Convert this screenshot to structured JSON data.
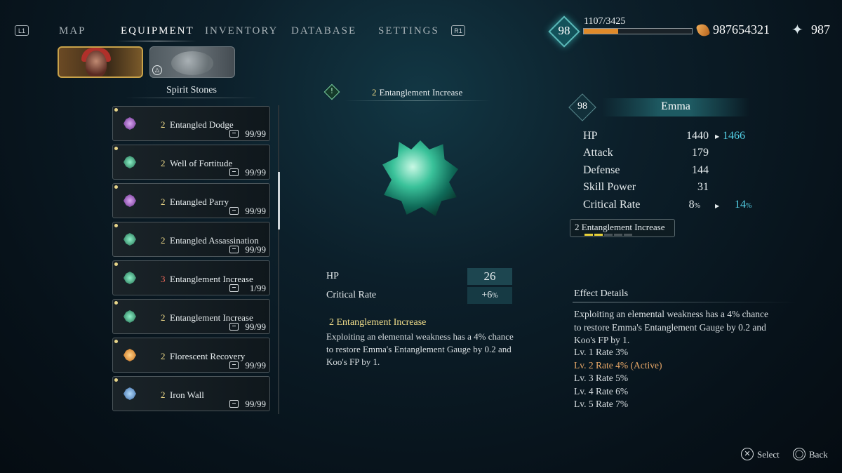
{
  "nav": {
    "left_trigger": "L1",
    "right_trigger": "R1",
    "tabs": [
      "MAP",
      "EQUIPMENT",
      "INVENTORY",
      "DATABASE",
      "SETTINGS"
    ],
    "active_tab": "EQUIPMENT"
  },
  "player": {
    "level": "98",
    "xp": "1107/3425",
    "xp_fraction": 0.32,
    "amber": "987654321",
    "spirit_points": "987"
  },
  "characters": {
    "second_tab_button": "△"
  },
  "list": {
    "title": "Spirit Stones",
    "items": [
      {
        "level": "2",
        "name": "Entangled Dodge",
        "qty": "99/99",
        "gem": "purple"
      },
      {
        "level": "2",
        "name": "Well of Fortitude",
        "qty": "99/99",
        "gem": "green"
      },
      {
        "level": "2",
        "name": "Entangled Parry",
        "qty": "99/99",
        "gem": "purple"
      },
      {
        "level": "2",
        "name": "Entangled Assassination",
        "qty": "99/99",
        "gem": "green"
      },
      {
        "level": "3",
        "name": "Entanglement Increase",
        "qty": "1/99",
        "gem": "green"
      },
      {
        "level": "2",
        "name": "Entanglement Increase",
        "qty": "99/99",
        "gem": "green"
      },
      {
        "level": "2",
        "name": "Florescent Recovery",
        "qty": "99/99",
        "gem": "orange"
      },
      {
        "level": "2",
        "name": "Iron Wall",
        "qty": "99/99",
        "gem": "blue"
      }
    ]
  },
  "detail": {
    "warn_glyph": "!",
    "level": "2",
    "title": "Entanglement Increase",
    "stats": [
      {
        "label": "HP",
        "value": "26"
      },
      {
        "label": "Critical Rate",
        "value": "+6",
        "unit": "%"
      }
    ],
    "desc_level": "2",
    "desc_title": "Entanglement Increase",
    "desc_pre1": "Exploiting an elemental weakness has a ",
    "desc_b1": "4%",
    "desc_pre2": " chance to restore Emma's Entanglement Gauge by ",
    "desc_b2": "0.2",
    "desc_pre3": " and Koo's FP by ",
    "desc_b3": "1",
    "desc_end": "."
  },
  "character": {
    "level": "98",
    "name": "Emma",
    "stats": {
      "hp_label": "HP",
      "hp": "1440",
      "hp_new": "1466",
      "attack_label": "Attack",
      "attack": "179",
      "defense_label": "Defense",
      "defense": "144",
      "skill_label": "Skill Power",
      "skill": "31",
      "crit_label": "Critical Rate",
      "crit": "8",
      "crit_new": "14",
      "pct": "%"
    },
    "equipped": {
      "level": "2",
      "name": "Entanglement Increase",
      "segments_filled": 2,
      "segments_total": 5
    }
  },
  "effects": {
    "label": "Effect Details",
    "pre1": "Exploiting an elemental weakness has a ",
    "b1": "4%",
    "pre2": " chance to restore Emma's Entanglement Gauge by ",
    "b2": "0.2",
    "pre3": " and Koo's FP by ",
    "b3": "1",
    "end": ".",
    "levels": [
      {
        "lv": "Lv. ",
        "n": "1",
        "rate": " Rate ",
        "v": "3%",
        "suffix": ""
      },
      {
        "lv": "Lv. ",
        "n": "2",
        "rate": " Rate ",
        "v": "4%",
        "suffix": " (Active)"
      },
      {
        "lv": "Lv. ",
        "n": "3",
        "rate": " Rate ",
        "v": "5%",
        "suffix": ""
      },
      {
        "lv": "Lv. ",
        "n": "4",
        "rate": " Rate ",
        "v": "6%",
        "suffix": ""
      },
      {
        "lv": "Lv. ",
        "n": "5",
        "rate": " Rate ",
        "v": "7%",
        "suffix": ""
      }
    ]
  },
  "footer": {
    "select_glyph": "✕",
    "select": "Select",
    "back_glyph": "◯",
    "back": "Back"
  },
  "colors": {
    "accent_gold": "#f0dc8a",
    "stat_increase": "#55d2e8",
    "active_level": "#e8a868",
    "xp_bar": "#e08a2a"
  }
}
